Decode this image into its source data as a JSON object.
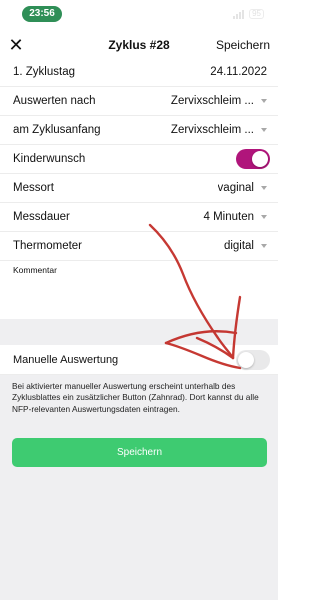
{
  "status_bar": {
    "time": "23:56",
    "battery": "95"
  },
  "nav": {
    "title": "Zyklus #28",
    "save_label": "Speichern",
    "close_symbol": "✕"
  },
  "rows": [
    {
      "label": "1. Zyklustag",
      "value": "24.11.2022",
      "type": "text"
    },
    {
      "label": "Auswerten nach",
      "value": "Zervixschleim ...",
      "type": "select"
    },
    {
      "label": "am Zyklusanfang",
      "value": "Zervixschleim ...",
      "type": "select"
    },
    {
      "label": "Kinderwunsch",
      "on": true,
      "type": "toggle"
    },
    {
      "label": "Messort",
      "value": "vaginal",
      "type": "select"
    },
    {
      "label": "Messdauer",
      "value": "4 Minuten",
      "type": "select"
    },
    {
      "label": "Thermometer",
      "value": "digital",
      "type": "select"
    }
  ],
  "comment": {
    "label": "Kommentar"
  },
  "manual": {
    "label": "Manuelle Auswertung",
    "on": false,
    "info": "Bei aktivierter manueller Auswertung erscheint unterhalb des Zyklusblattes ein zusätzlicher Button (Zahnrad). Dort kannst du alle NFP-relevanten Auswertungsdaten eintragen."
  },
  "save_button": {
    "label": "Speichern"
  },
  "colors": {
    "toggle_on": "#b0157b",
    "save_button": "#3ecb71",
    "status_pill": "#2f8f57",
    "annotation": "#c0241e"
  }
}
